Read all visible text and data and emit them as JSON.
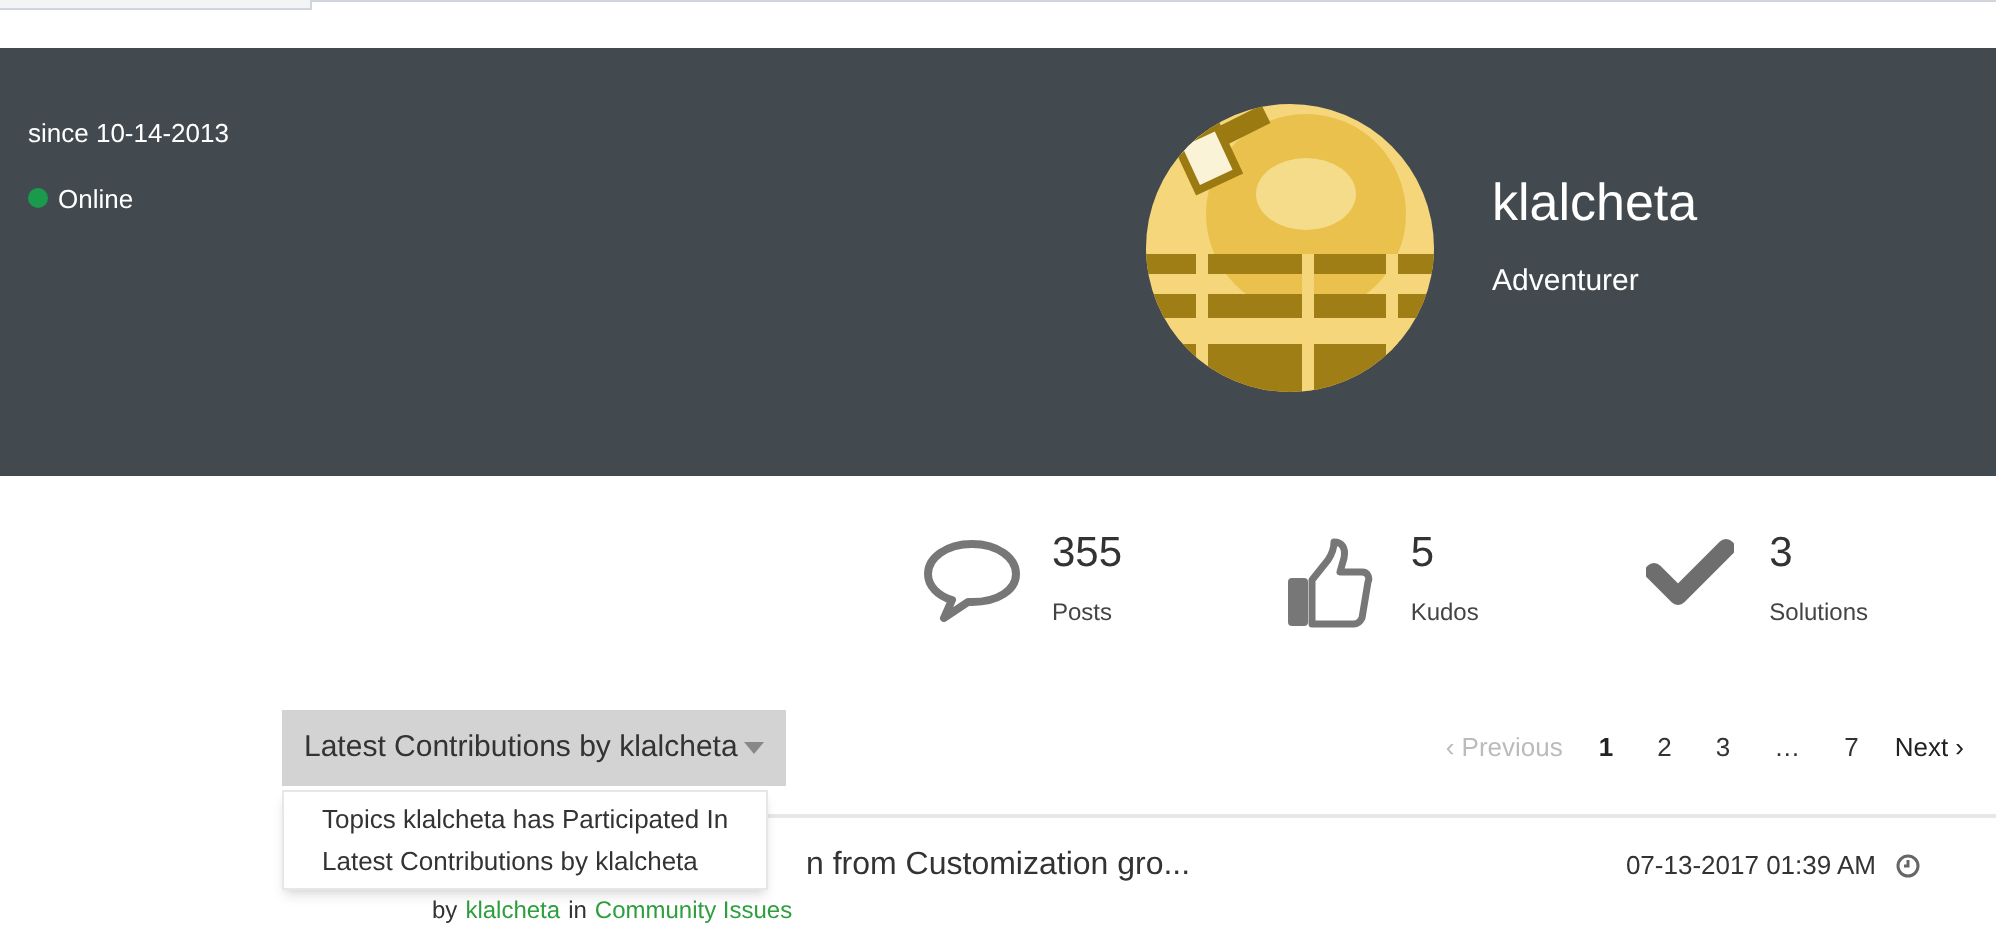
{
  "profile": {
    "member_since": "since 10-14-2013",
    "status": {
      "label": "Online",
      "online": true
    },
    "username": "klalcheta",
    "rank": "Adventurer"
  },
  "stats": [
    {
      "kind": "posts",
      "value": "355",
      "label": "Posts"
    },
    {
      "kind": "kudos",
      "value": "5",
      "label": "Kudos"
    },
    {
      "kind": "solutions",
      "value": "3",
      "label": "Solutions"
    }
  ],
  "contributions_dropdown": {
    "label": "Latest Contributions by klalcheta",
    "expanded": true,
    "options": [
      "Topics klalcheta has Participated In",
      "Latest Contributions by klalcheta"
    ]
  },
  "pagination": {
    "previous": {
      "chevron": "‹",
      "label": "Previous",
      "disabled": true
    },
    "pages": [
      {
        "label": "1",
        "selected": true
      },
      {
        "label": "2",
        "selected": false
      },
      {
        "label": "3",
        "selected": false
      },
      {
        "label": "…",
        "selected": false
      },
      {
        "label": "7",
        "selected": false
      }
    ],
    "next": {
      "label": "Next",
      "chevron": "›",
      "disabled": false
    }
  },
  "posts": [
    {
      "title": "n from Customization gro...",
      "by": "by",
      "author": "klalcheta",
      "in": "in",
      "board": "Community Issues",
      "date": "07-13-2017 01:39 AM"
    }
  ]
}
